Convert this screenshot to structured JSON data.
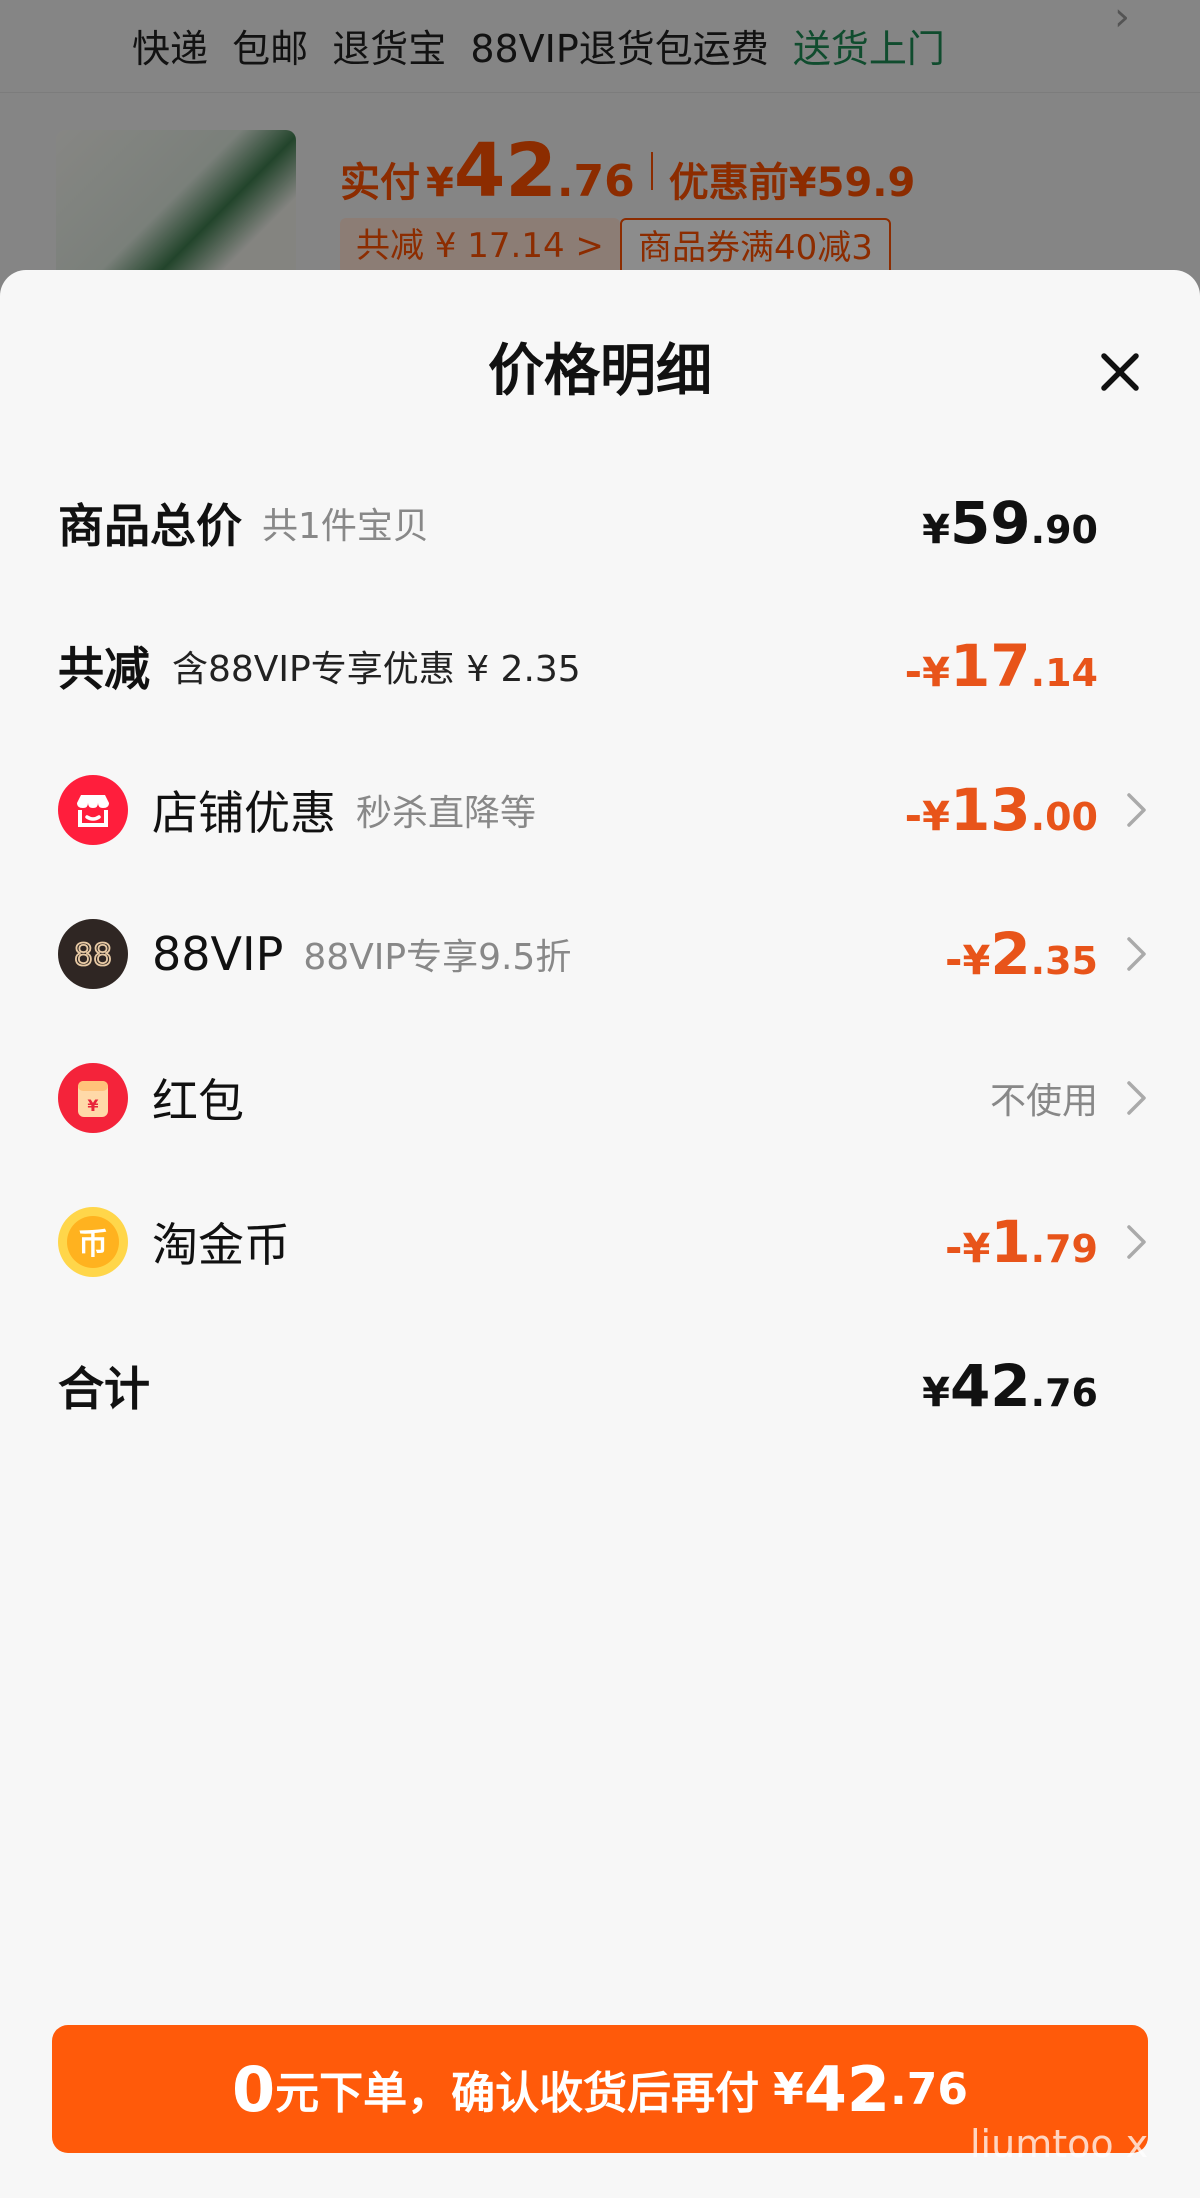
{
  "background": {
    "delivery_items": [
      "快递",
      "包邮",
      "退货宝",
      "88VIP退货包运费"
    ],
    "delivery_highlight": "送货上门",
    "paid_label": "实付",
    "paid_yen": "¥",
    "paid_int": "42",
    "paid_dec": ".76",
    "original_label": "优惠前¥59.9",
    "reduce_tag": "共减 ¥ 17.14 >",
    "coupon_tag": "商品券满40减3",
    "colors": {
      "accent": "#ff5000",
      "green": "#1e8a55"
    }
  },
  "sheet": {
    "title": "价格明细",
    "close_icon": "close-icon",
    "rows": {
      "total": {
        "label": "商品总价",
        "sub": "共1件宝贝",
        "yen": "¥",
        "int": "59",
        "dec": ".90"
      },
      "reduce": {
        "label": "共减",
        "sub": "含88VIP专享优惠 ¥ 2.35",
        "minus": "-",
        "yen": "¥",
        "int": "17",
        "dec": ".14"
      },
      "store": {
        "icon": "store-icon",
        "label": "店铺优惠",
        "sub": "秒杀直降等",
        "minus": "-",
        "yen": "¥",
        "int": "13",
        "dec": ".00"
      },
      "vip": {
        "icon": "88vip-icon",
        "label": "88VIP",
        "sub": "88VIP专享9.5折",
        "minus": "-",
        "yen": "¥",
        "int": "2",
        "dec": ".35"
      },
      "hongbao": {
        "icon": "red-packet-icon",
        "label": "红包",
        "status": "不使用"
      },
      "coin": {
        "icon": "coin-icon",
        "label": "淘金币",
        "minus": "-",
        "yen": "¥",
        "int": "1",
        "dec": ".79"
      },
      "sum": {
        "label": "合计",
        "yen": "¥",
        "int": "42",
        "dec": ".76"
      }
    },
    "colors": {
      "discount": "#e8541a",
      "button": "#ff5a0a"
    }
  },
  "confirm_button": {
    "lead_number": "0",
    "text": "元下单，确认收货后再付",
    "yen": "¥",
    "int": "42",
    "dec": ".76"
  },
  "watermark": "liumtoo x"
}
